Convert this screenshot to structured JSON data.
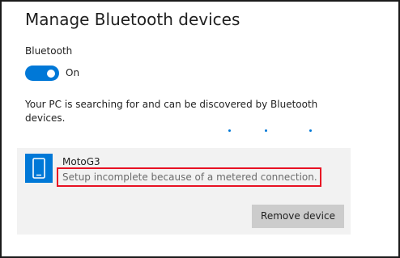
{
  "page": {
    "title": "Manage Bluetooth devices"
  },
  "bluetooth": {
    "label": "Bluetooth",
    "toggle_state": "On",
    "toggle_on": true,
    "accent_color": "#0078d7"
  },
  "discovery": {
    "message": "Your PC is searching for and can be discovered by Bluetooth devices.",
    "progress_indicator": "animated-dots"
  },
  "device": {
    "icon": "phone-icon",
    "name": "MotoG3",
    "status": "Setup incomplete because of a metered connection.",
    "highlight_color": "#e81123",
    "remove_label": "Remove device"
  }
}
